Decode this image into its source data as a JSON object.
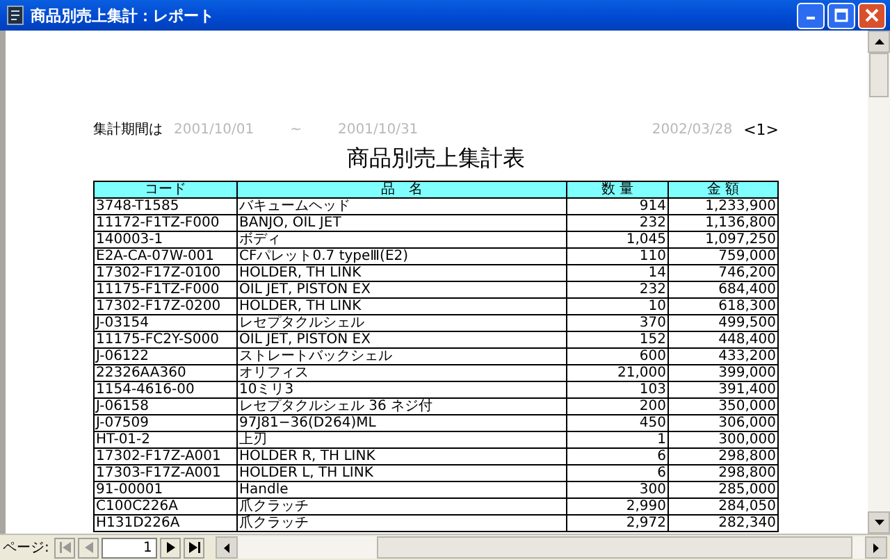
{
  "window": {
    "title": "商品別売上集計：レポート"
  },
  "report": {
    "period_label": "集計期間は",
    "period_from": "2001/10/01",
    "period_sep": "~",
    "period_to": "2001/10/31",
    "print_date": "2002/03/28",
    "page_marker": "<1>",
    "title": "商品別売上集計表",
    "columns": [
      "コード",
      "品　名",
      "数 量",
      "金 額"
    ],
    "rows": [
      {
        "code": "3748-T1585",
        "name": "バキュームヘッド",
        "qty": "914",
        "amount": "1,233,900"
      },
      {
        "code": "11172-F1TZ-F000",
        "name": "BANJO, OIL JET",
        "qty": "232",
        "amount": "1,136,800"
      },
      {
        "code": "140003-1",
        "name": "ボディ",
        "qty": "1,045",
        "amount": "1,097,250"
      },
      {
        "code": "E2A-CA-07W-001",
        "name": "CFパレット0.7 typeⅢ(E2)",
        "qty": "110",
        "amount": "759,000"
      },
      {
        "code": "17302-F17Z-0100",
        "name": "HOLDER, TH LINK",
        "qty": "14",
        "amount": "746,200"
      },
      {
        "code": "11175-F1TZ-F000",
        "name": "OIL JET, PISTON EX",
        "qty": "232",
        "amount": "684,400"
      },
      {
        "code": "17302-F17Z-0200",
        "name": "HOLDER, TH LINK",
        "qty": "10",
        "amount": "618,300"
      },
      {
        "code": "J-03154",
        "name": "レセプタクルシェル",
        "qty": "370",
        "amount": "499,500"
      },
      {
        "code": "11175-FC2Y-S000",
        "name": "OIL JET, PISTON EX",
        "qty": "152",
        "amount": "448,400"
      },
      {
        "code": "J-06122",
        "name": "ストレートバックシェル",
        "qty": "600",
        "amount": "433,200"
      },
      {
        "code": "22326AA360",
        "name": "オリフィス",
        "qty": "21,000",
        "amount": "399,000"
      },
      {
        "code": "1154-4616-00",
        "name": "10ミリ3",
        "qty": "103",
        "amount": "391,400"
      },
      {
        "code": "J-06158",
        "name": "レセプタクルシェル 36 ネジ付",
        "qty": "200",
        "amount": "350,000"
      },
      {
        "code": "J-07509",
        "name": "97J81−36(D264)ML",
        "qty": "450",
        "amount": "306,000"
      },
      {
        "code": "HT-01-2",
        "name": "上刃",
        "qty": "1",
        "amount": "300,000"
      },
      {
        "code": "17302-F17Z-A001",
        "name": "HOLDER R, TH LINK",
        "qty": "6",
        "amount": "298,800"
      },
      {
        "code": "17303-F17Z-A001",
        "name": "HOLDER L, TH LINK",
        "qty": "6",
        "amount": "298,800"
      },
      {
        "code": "91-00001",
        "name": "Handle",
        "qty": "300",
        "amount": "285,000"
      },
      {
        "code": "C100C226A",
        "name": "爪クラッチ",
        "qty": "2,990",
        "amount": "284,050"
      },
      {
        "code": "H131D226A",
        "name": "爪クラッチ",
        "qty": "2,972",
        "amount": "282,340"
      }
    ]
  },
  "navigator": {
    "label": "ページ:",
    "page": "1"
  }
}
